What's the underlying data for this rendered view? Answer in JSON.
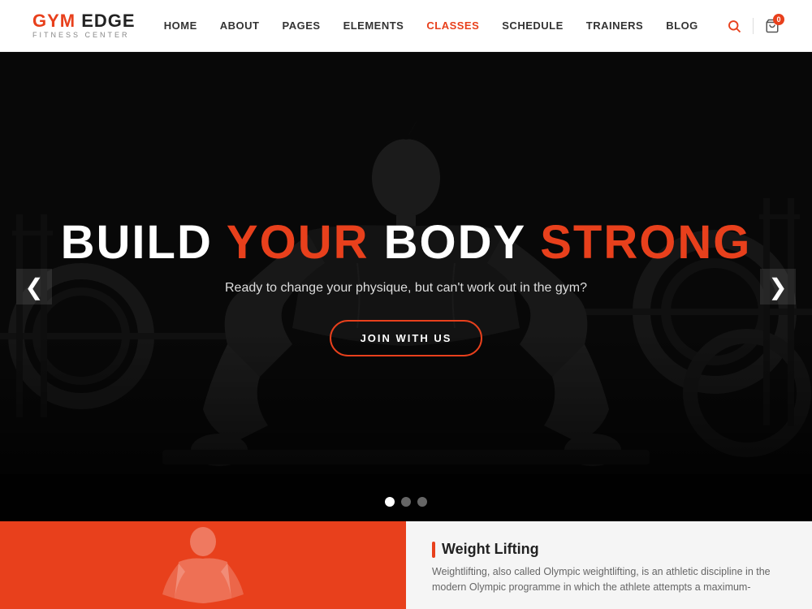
{
  "logo": {
    "gym": "GYM",
    "edge": " EDGE",
    "subtitle": "FITNESS CENTER"
  },
  "nav": {
    "items": [
      {
        "label": "HOME",
        "id": "home",
        "active": false
      },
      {
        "label": "ABOUT",
        "id": "about",
        "active": false
      },
      {
        "label": "PAGES",
        "id": "pages",
        "active": false
      },
      {
        "label": "ELEMENTS",
        "id": "elements",
        "active": false
      },
      {
        "label": "CLASSES",
        "id": "classes",
        "active": true
      },
      {
        "label": "SCHEDULE",
        "id": "schedule",
        "active": false
      },
      {
        "label": "TRAINERS",
        "id": "trainers",
        "active": false
      },
      {
        "label": "BLOG",
        "id": "blog",
        "active": false
      }
    ],
    "cart_count": "0"
  },
  "hero": {
    "title_part1": "BUILD ",
    "title_orange1": "YOUR",
    "title_part2": " BODY ",
    "title_orange2": "STRONG",
    "subtitle": "Ready to change your physique, but can't work out in the gym?",
    "cta_label": "JOIN WITH US",
    "arrow_left": "❮",
    "arrow_right": "❯",
    "dots": [
      {
        "active": true
      },
      {
        "active": false
      },
      {
        "active": false
      }
    ]
  },
  "bottom": {
    "section_title": "Weight Lifting",
    "section_text": "Weightlifting, also called Olympic weightlifting, is an athletic discipline in the modern Olympic programme in which the athlete attempts a maximum-"
  },
  "colors": {
    "orange": "#e8401c",
    "white": "#ffffff",
    "dark": "#111111"
  }
}
